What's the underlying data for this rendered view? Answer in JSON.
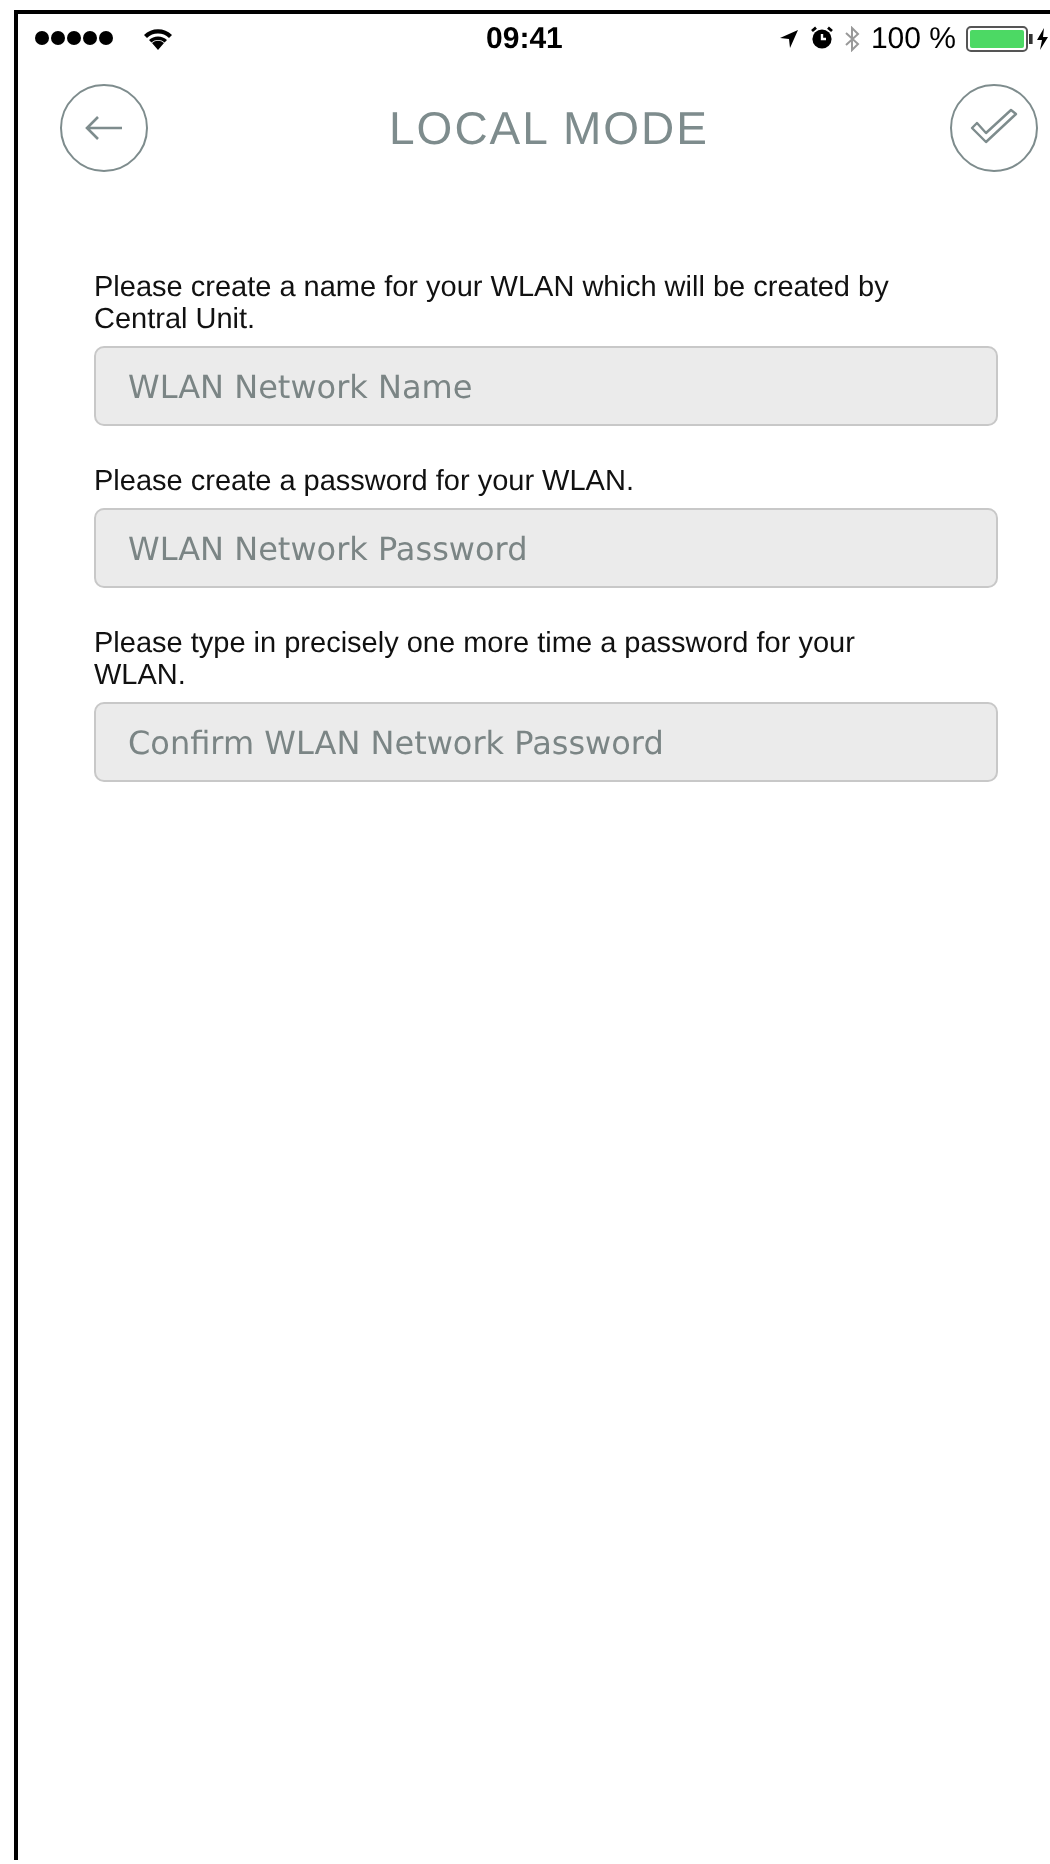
{
  "status_bar": {
    "time": "09:41",
    "battery": "100 %"
  },
  "header": {
    "title": "LOCAL MODE"
  },
  "fields": [
    {
      "label": "Please create a name for your WLAN which will be created by Central Unit.",
      "placeholder": "WLAN Network Name"
    },
    {
      "label": "Please create a password for your WLAN.",
      "placeholder": "WLAN Network Password"
    },
    {
      "label": "Please type in precisely one more time a password for your WLAN.",
      "placeholder": "Confirm WLAN Network Password"
    }
  ]
}
